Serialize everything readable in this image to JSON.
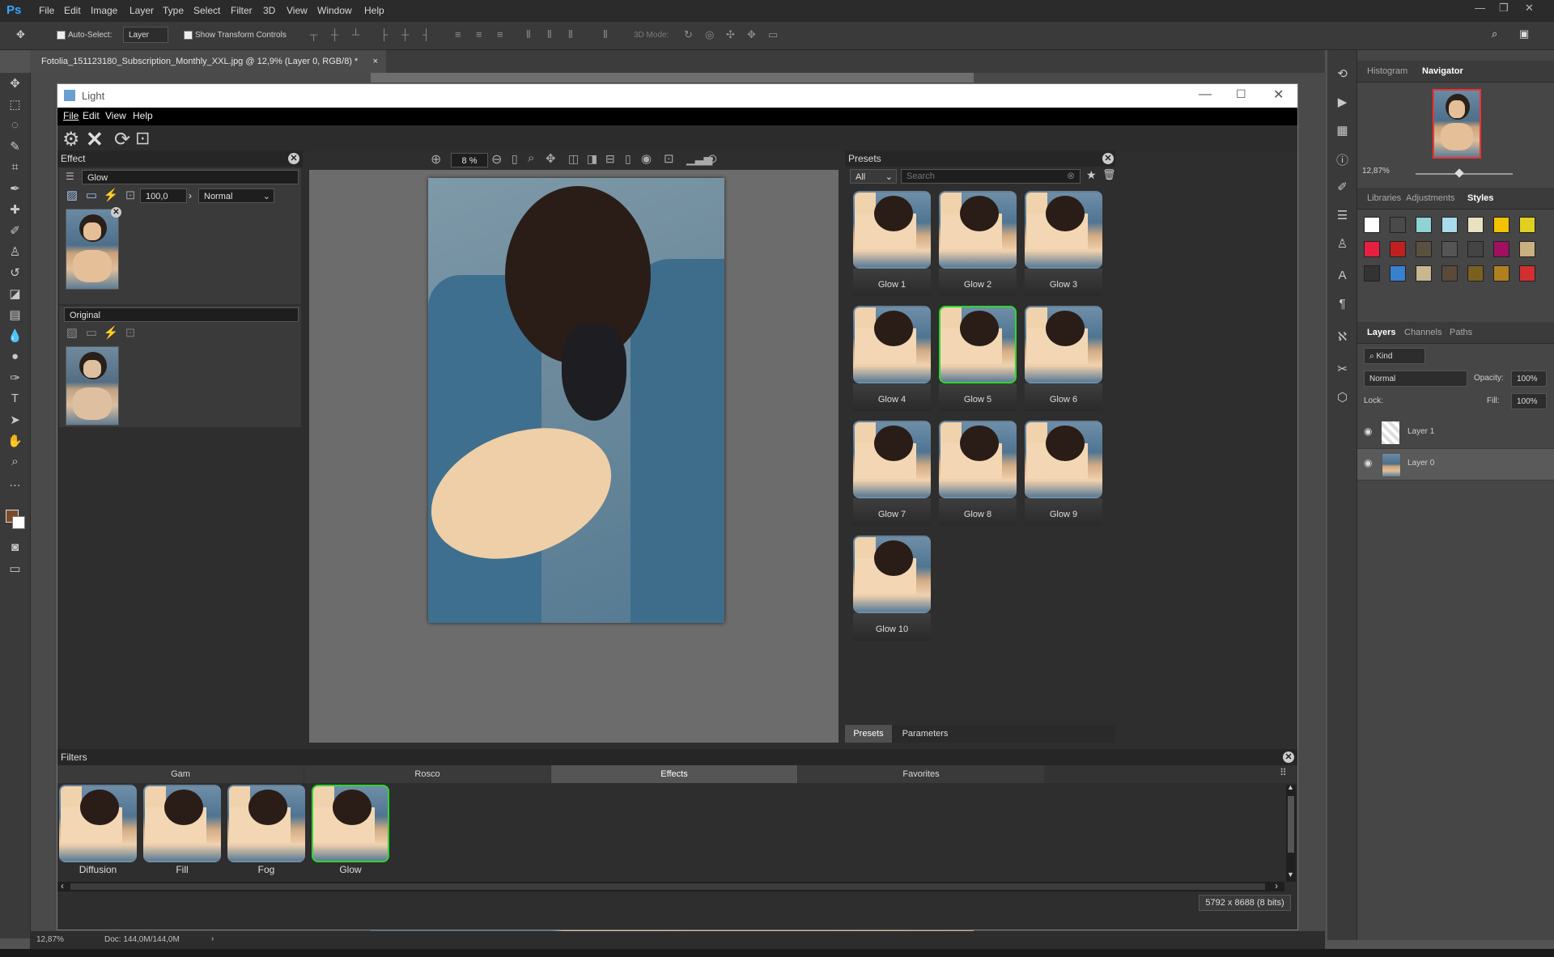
{
  "ps": {
    "logo": "Ps",
    "menu": [
      "File",
      "Edit",
      "Image",
      "Layer",
      "Type",
      "Select",
      "Filter",
      "3D",
      "View",
      "Window",
      "Help"
    ],
    "options": {
      "auto_select_label": "Auto-Select:",
      "auto_select_value": "Layer",
      "transform_label": "Show Transform Controls",
      "mode_3d_label": "3D Mode:"
    },
    "doc_tab": "Fotolia_151123180_Subscription_Monthly_XXL.jpg @ 12,9% (Layer 0, RGB/8) *",
    "doc_tab_close": "×",
    "status": {
      "zoom": "12,87%",
      "doc": "Doc: 144,0M/144,0M",
      "arrow": "›"
    },
    "navigator": {
      "tabs": [
        "Histogram",
        "Navigator"
      ],
      "zoom": "12,87%"
    },
    "style_tabs": [
      "Libraries",
      "Adjustments",
      "Styles"
    ],
    "layers_tabs": [
      "Layers",
      "Channels",
      "Paths"
    ],
    "layers_controls": {
      "kind": "Kind",
      "blend": "Normal",
      "opacity_label": "Opacity:",
      "opacity": "100%",
      "lock_label": "Lock:",
      "fill_label": "Fill:",
      "fill": "100%"
    },
    "layers": [
      {
        "name": "Layer 1"
      },
      {
        "name": "Layer 0"
      }
    ]
  },
  "light": {
    "title": "Light",
    "menu": [
      "File",
      "Edit",
      "View",
      "Help"
    ],
    "effect_panel": {
      "title": "Effect",
      "effect_name": "Glow",
      "amount": "100,0",
      "blend": "Normal",
      "original_label": "Original"
    },
    "canvas": {
      "zoom": "8 %",
      "size_info": "5792 x 8688 (8 bits)"
    },
    "presets_panel": {
      "title": "Presets",
      "filter": "All",
      "search_placeholder": "Search",
      "items": [
        "Glow 1",
        "Glow 2",
        "Glow 3",
        "Glow 4",
        "Glow 5",
        "Glow 6",
        "Glow 7",
        "Glow 8",
        "Glow 9",
        "Glow 10"
      ],
      "selected": "Glow 5",
      "bottom_tabs": [
        "Presets",
        "Parameters"
      ]
    },
    "filters_panel": {
      "title": "Filters",
      "tabs": [
        "Gam",
        "Rosco",
        "Effects",
        "Favorites"
      ],
      "active_tab": "Effects",
      "items": [
        "Diffusion",
        "Fill",
        "Fog",
        "Glow"
      ],
      "selected": "Glow"
    }
  },
  "colors": {
    "accent_green": "#2fd62f",
    "ps_blue": "#31a8ff"
  }
}
